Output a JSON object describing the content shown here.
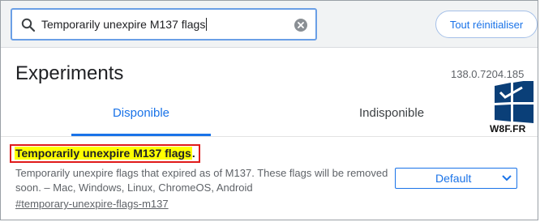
{
  "search": {
    "query": "Temporarily unexpire M137 flags",
    "icon": "search-icon",
    "clear_icon": "clear-icon"
  },
  "header": {
    "reset_label": "Tout réinitialiser"
  },
  "page": {
    "title": "Experiments",
    "version": "138.0.7204.185"
  },
  "tabs": [
    {
      "label": "Disponible",
      "active": true
    },
    {
      "label": "Indisponible",
      "active": false
    }
  ],
  "watermark": {
    "text": "W8F.FR"
  },
  "flag": {
    "title": "Temporarily unexpire M137 flags",
    "title_suffix": ".",
    "description": "Temporarily unexpire flags that expired as of M137. These flags will be removed soon. – Mac, Windows, Linux, ChromeOS, Android",
    "link": "#temporary-unexpire-flags-m137",
    "select_value": "Default"
  },
  "colors": {
    "accent": "#1a73e8",
    "highlight": "#ffff00",
    "annotation_border": "#e01a1a"
  }
}
